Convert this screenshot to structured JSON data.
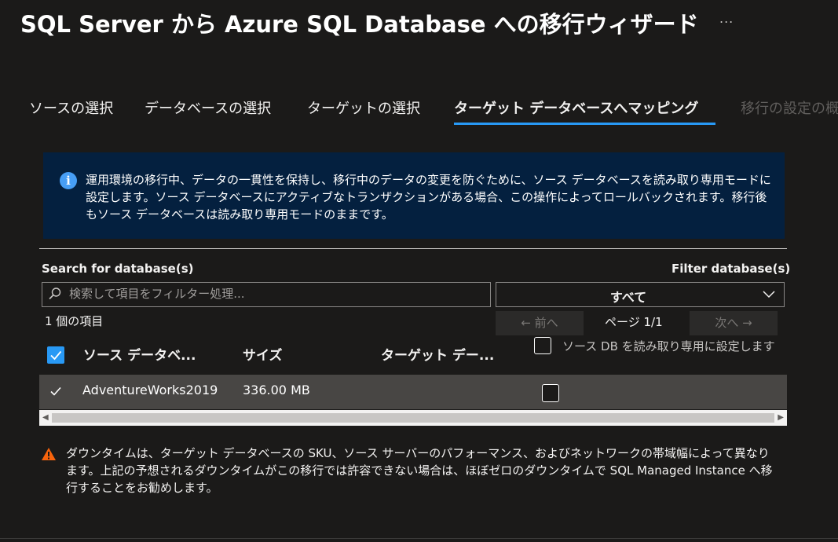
{
  "title": "SQL Server から Azure SQL Database への移行ウィザード",
  "more_label": "...",
  "tabs": [
    {
      "label": "ソースの選択",
      "state": "normal"
    },
    {
      "label": "データベースの選択",
      "state": "normal"
    },
    {
      "label": "ターゲットの選択",
      "state": "normal"
    },
    {
      "label": "ターゲット データベースへマッピング",
      "state": "active"
    },
    {
      "label": "移行の設定の概要",
      "state": "disabled"
    }
  ],
  "info": {
    "icon": "info-icon",
    "text": "運用環境の移行中、データの一貫性を保持し、移行中のデータの変更を防ぐために、ソース データベースを読み取り専用モードに設定します。ソース データベースにアクティブなトランザクションがある場合、この操作によってロールバックされます。移行後もソース データベースは読み取り専用モードのままです。"
  },
  "search": {
    "label": "Search for database(s)",
    "placeholder": "検索して項目をフィルター処理...",
    "value": ""
  },
  "filter": {
    "label": "Filter database(s)",
    "selected": "すべて"
  },
  "item_count": "1 個の項目",
  "pagination": {
    "prev": "← 前へ",
    "page": "ページ 1/1",
    "next": "次へ →"
  },
  "table": {
    "columns": [
      "ソース データベース",
      "サイズ",
      "ターゲット データベース"
    ],
    "columns_display": [
      "ソース データベ...",
      "サイズ",
      "ターゲット デー..."
    ],
    "readonly_label": "ソース DB を読み取り専用に設定します",
    "rows": [
      {
        "source": "AdventureWorks2019",
        "size": "336.00 MB",
        "selected": true,
        "readonly": false
      }
    ]
  },
  "warning": {
    "icon": "warning-icon",
    "text": "ダウンタイムは、ターゲット データベースの SKU、ソース サーバーのパフォーマンス、およびネットワークの帯域幅によって異なります。上記の予想されるダウンタイムがこの移行では許容できない場合は、ほぼゼロのダウンタイムで SQL Managed Instance へ移行することをお勧めします。"
  },
  "colors": {
    "accent": "#2899f5",
    "info_bg": "#04203f",
    "warning": "#f7630c",
    "background": "#1b1a19"
  }
}
